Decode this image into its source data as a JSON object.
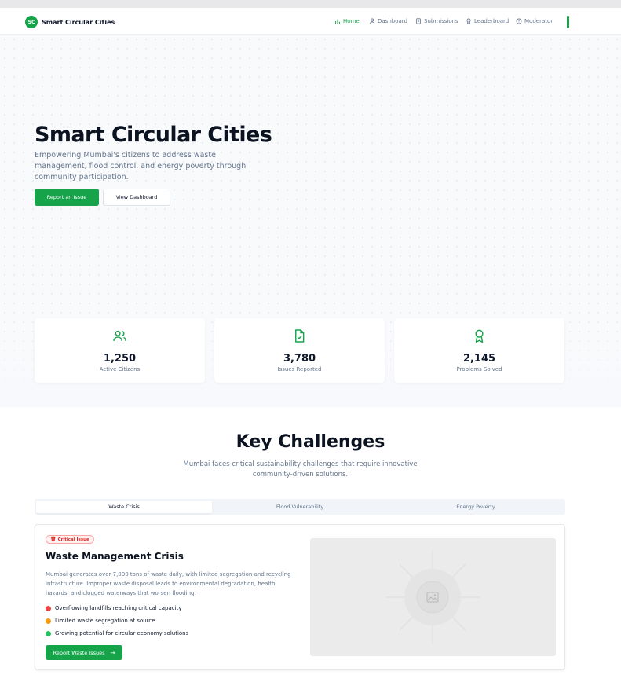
{
  "app": {
    "brand_initials": "SC",
    "brand_name": "Smart Circular Cities"
  },
  "nav": {
    "items": [
      {
        "label": "Home",
        "icon": "bar-chart-icon",
        "active": true
      },
      {
        "label": "Dashboard",
        "icon": "user-icon",
        "active": false
      },
      {
        "label": "Submissions",
        "icon": "document-icon",
        "active": false
      },
      {
        "label": "Leaderboard",
        "icon": "award-icon",
        "active": false
      },
      {
        "label": "Moderator",
        "icon": "shield-icon",
        "active": false
      }
    ]
  },
  "hero": {
    "title": "Smart Circular Cities",
    "subtitle": "Empowering Mumbai's citizens to address waste management, flood control, and energy poverty through community participation.",
    "primary_button": "Report an Issue",
    "secondary_button": "View Dashboard"
  },
  "stats": [
    {
      "value": "1,250",
      "label": "Active Citizens",
      "icon": "users-icon"
    },
    {
      "value": "3,780",
      "label": "Issues Reported",
      "icon": "file-check-icon"
    },
    {
      "value": "2,145",
      "label": "Problems Solved",
      "icon": "award-icon"
    }
  ],
  "challenges": {
    "title": "Key Challenges",
    "subtitle": "Mumbai faces critical sustainability challenges that require innovative community-driven solutions.",
    "tabs": [
      {
        "label": "Waste Crisis",
        "active": true
      },
      {
        "label": "Flood Vulnerability",
        "active": false
      },
      {
        "label": "Energy Poverty",
        "active": false
      }
    ]
  },
  "card": {
    "badge": "Critical Issue",
    "badge_icon": "trash-icon",
    "title": "Waste Management Crisis",
    "description": "Mumbai generates over 7,000 tons of waste daily, with limited segregation and recycling infrastructure. Improper waste disposal leads to environmental degradation, health hazards, and clogged waterways that worsen flooding.",
    "bullets": [
      {
        "text": "Overflowing landfills reaching critical capacity",
        "color": "#ef4444"
      },
      {
        "text": "Limited waste segregation at source",
        "color": "#f59e0b"
      },
      {
        "text": "Growing potential for circular economy solutions",
        "color": "#22c55e"
      }
    ],
    "button": "Report Waste Issues",
    "image_icon": "image-placeholder-icon"
  },
  "colors": {
    "accent": "#16a34a",
    "critical": "#dc2626"
  }
}
